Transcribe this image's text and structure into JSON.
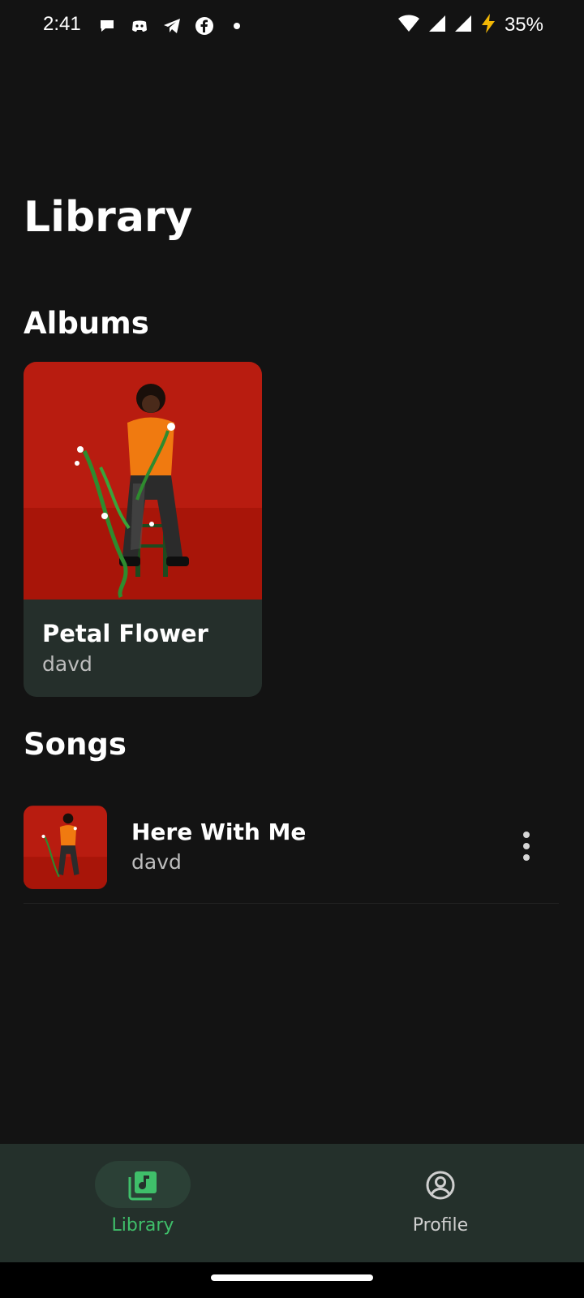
{
  "status_bar": {
    "time": "2:41",
    "notification_icons": [
      "chat-bubble-icon",
      "discord-icon",
      "telegram-icon",
      "facebook-icon",
      "dot-icon"
    ],
    "battery": "35%"
  },
  "library": {
    "title": "Library",
    "albums_heading": "Albums",
    "albums": [
      {
        "name": "Petal Flower",
        "artist": "davd"
      }
    ],
    "songs_heading": "Songs",
    "songs": [
      {
        "title": "Here With Me",
        "artist": "davd"
      }
    ]
  },
  "bottom_nav": {
    "items": [
      {
        "label": "Library",
        "icon": "music-library-icon",
        "active": true
      },
      {
        "label": "Profile",
        "icon": "profile-icon",
        "active": false
      }
    ]
  },
  "colors": {
    "background": "#131313",
    "card": "#252f2b",
    "accent": "#3fbf6a",
    "nav_background": "#24302b",
    "cover_red": "#b81c10"
  }
}
